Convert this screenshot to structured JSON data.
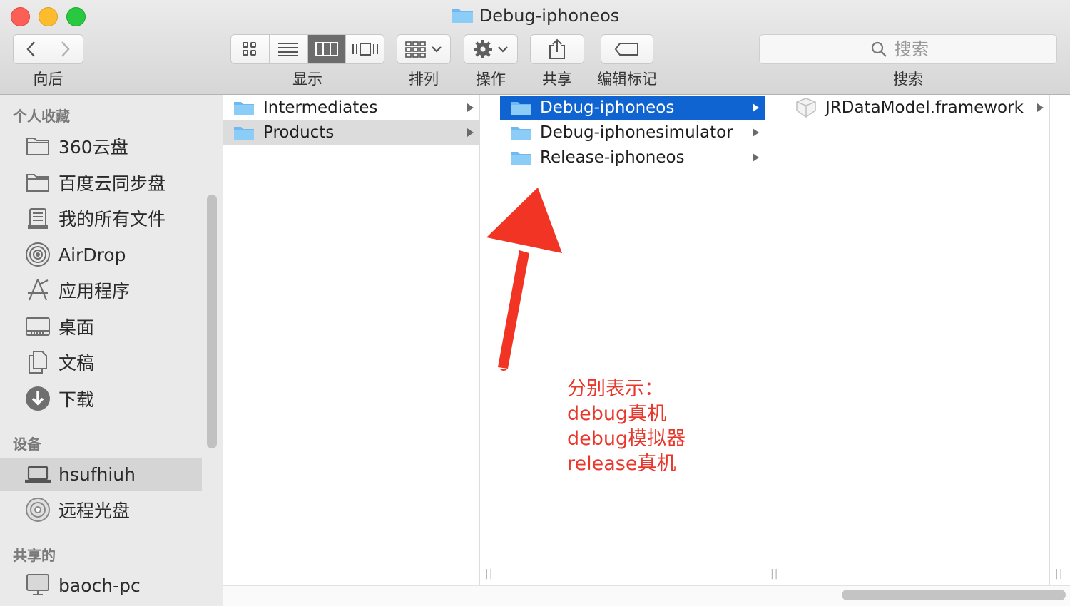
{
  "window": {
    "title": "Debug-iphoneos"
  },
  "toolbar": {
    "back_forward_label": "向后",
    "view_label": "显示",
    "arrange_label": "排列",
    "action_label": "操作",
    "share_label": "共享",
    "tags_label": "编辑标记",
    "search_label": "搜索",
    "search_placeholder": "搜索"
  },
  "sidebar": {
    "favorites_header": "个人收藏",
    "favorites": [
      {
        "label": "360云盘",
        "icon": "folder-icon"
      },
      {
        "label": "百度云同步盘",
        "icon": "folder-icon"
      },
      {
        "label": "我的所有文件",
        "icon": "all-files-icon"
      },
      {
        "label": "AirDrop",
        "icon": "airdrop-icon"
      },
      {
        "label": "应用程序",
        "icon": "applications-icon"
      },
      {
        "label": "桌面",
        "icon": "desktop-icon"
      },
      {
        "label": "文稿",
        "icon": "documents-icon"
      },
      {
        "label": "下载",
        "icon": "downloads-icon"
      }
    ],
    "devices_header": "设备",
    "devices": [
      {
        "label": "hsufhiuh",
        "icon": "laptop-icon",
        "selected": true
      },
      {
        "label": "远程光盘",
        "icon": "disc-icon"
      }
    ],
    "shared_header": "共享的",
    "shared": [
      {
        "label": "baoch-pc",
        "icon": "computer-icon"
      }
    ]
  },
  "columns": [
    {
      "items": [
        {
          "label": "Intermediates",
          "state": "none"
        },
        {
          "label": "Products",
          "state": "grey"
        }
      ]
    },
    {
      "items": [
        {
          "label": "Debug-iphoneos",
          "state": "blue"
        },
        {
          "label": "Debug-iphonesimulator",
          "state": "none"
        },
        {
          "label": "Release-iphoneos",
          "state": "none"
        }
      ]
    },
    {
      "items": [
        {
          "label": "JRDataModel.framework",
          "state": "none"
        }
      ]
    }
  ],
  "annotation": {
    "lines": [
      "分别表示：",
      "debug真机",
      "debug模拟器",
      "release真机"
    ],
    "color": "#e8382c"
  },
  "colors": {
    "selection_blue": "#0f64d2",
    "folder_blue": "#74c0f5"
  }
}
